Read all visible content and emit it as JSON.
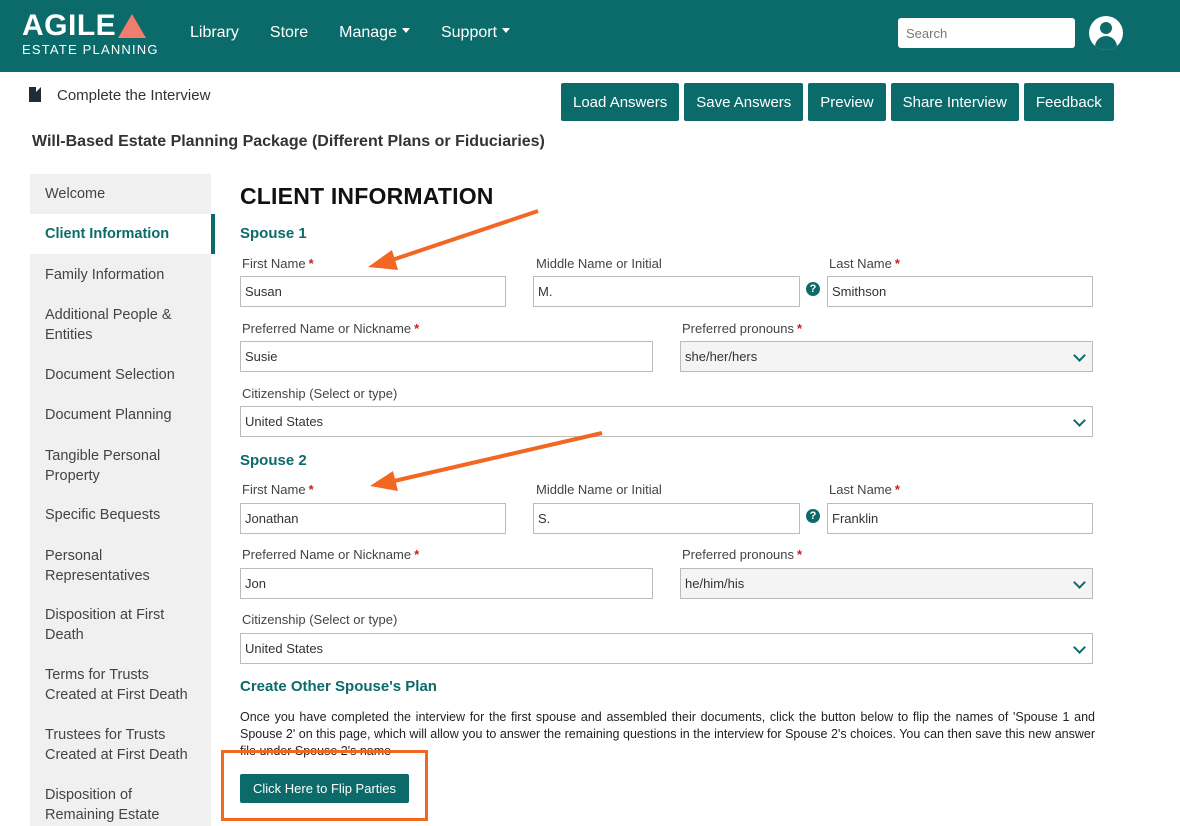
{
  "header": {
    "logo_main": "AGILE",
    "logo_sub": "ESTATE PLANNING",
    "nav": [
      "Library",
      "Store",
      "Manage",
      "Support"
    ],
    "search_placeholder": "Search"
  },
  "subheader": {
    "title": "Complete the Interview",
    "actions": [
      "Load Answers",
      "Save Answers",
      "Preview",
      "Share Interview",
      "Feedback"
    ],
    "package_title": "Will-Based Estate Planning Package (Different Plans or Fiduciaries)"
  },
  "sidebar": {
    "items": [
      {
        "label": "Welcome"
      },
      {
        "label": "Client Information"
      },
      {
        "label": "Family Information"
      },
      {
        "label": "Additional People & Entities"
      },
      {
        "label": "Document Selection"
      },
      {
        "label": "Document Planning"
      },
      {
        "label": "Tangible Personal Property"
      },
      {
        "label": "Specific Bequests"
      },
      {
        "label": "Personal Representatives"
      },
      {
        "label": "Disposition at First Death"
      },
      {
        "label": "Terms for Trusts Created at First Death"
      },
      {
        "label": "Trustees for Trusts Created at First Death"
      },
      {
        "label": "Disposition of Remaining Estate"
      }
    ]
  },
  "main": {
    "heading": "CLIENT INFORMATION",
    "labels": {
      "first": "First Name",
      "middle": "Middle Name or Initial",
      "last": "Last Name",
      "preferred": "Preferred Name or Nickname",
      "pronouns": "Preferred pronouns",
      "citizenship": "Citizenship (Select or type)",
      "help": "?"
    },
    "spouse1": {
      "heading": "Spouse 1",
      "first": "Susan",
      "middle": "M.",
      "last": "Smithson",
      "preferred": "Susie",
      "pronouns": "she/her/hers",
      "citizenship": "United States"
    },
    "spouse2": {
      "heading": "Spouse 2",
      "first": "Jonathan",
      "middle": "S.",
      "last": "Franklin",
      "preferred": "Jon",
      "pronouns": "he/him/his",
      "citizenship": "United States"
    },
    "other_plan": {
      "heading": "Create Other Spouse's Plan",
      "text": "Once you have completed the interview for the first spouse and assembled their documents, click the button below to flip the names of 'Spouse 1 and Spouse 2' on this page, which will allow you to answer the remaining questions in the interview for Spouse 2's choices. You can then save this new answer file under Spouse 2's name",
      "button": "Click Here to Flip Parties"
    }
  },
  "colors": {
    "brand": "#0b6b6a",
    "annotation": "#f26722",
    "required": "#cc1f1f"
  }
}
